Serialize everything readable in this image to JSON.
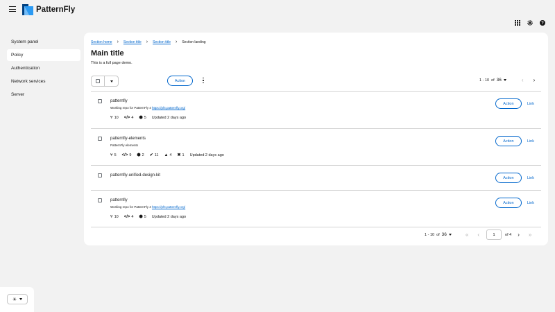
{
  "masthead": {
    "brand": "PatternFly",
    "icons": [
      "hamburger-icon",
      "grid-icon",
      "gear-icon",
      "help-icon"
    ]
  },
  "sidebar": {
    "items": [
      {
        "label": "System panel",
        "active": false
      },
      {
        "label": "Policy",
        "active": true
      },
      {
        "label": "Authentication",
        "active": false
      },
      {
        "label": "Network services",
        "active": false
      },
      {
        "label": "Server",
        "active": false
      }
    ],
    "theme_icon": "sun-icon"
  },
  "breadcrumb": {
    "items": [
      "Section home",
      "Section title",
      "Section title"
    ],
    "current": "Section landing"
  },
  "page": {
    "title": "Main title",
    "description": "This is a full page demo."
  },
  "toolbar": {
    "action_label": "Action"
  },
  "pagination": {
    "range": "1 - 10",
    "of": "of",
    "total": "36",
    "page_value": "1",
    "of_pages": "of 4"
  },
  "rows": [
    {
      "title": "patternfly",
      "desc_text": "Working repo for PatternFly 4",
      "desc_link": "https://pf4.patternfly.org/",
      "stats": [
        {
          "icon": "⑂",
          "value": "10",
          "name": "branch-icon"
        },
        {
          "icon": "</>",
          "value": "4",
          "name": "code-icon"
        },
        {
          "icon": "⬢",
          "value": "5",
          "name": "cube-icon"
        }
      ],
      "updated": "Updated 2 days ago",
      "action": "Action",
      "link": "Link"
    },
    {
      "title": "patternfly-elements",
      "desc_text": "PatternFly elements",
      "desc_link": "",
      "stats": [
        {
          "icon": "⑂",
          "value": "5",
          "name": "branch-icon"
        },
        {
          "icon": "</>",
          "value": "9",
          "name": "code-icon"
        },
        {
          "icon": "⬢",
          "value": "2",
          "name": "cube-icon"
        },
        {
          "icon": "✔",
          "value": "11",
          "name": "check-circle-icon"
        },
        {
          "icon": "▲",
          "value": "4",
          "name": "warning-icon"
        },
        {
          "icon": "✖",
          "value": "1",
          "name": "error-circle-icon"
        }
      ],
      "updated": "Updated 2 days ago",
      "action": "Action",
      "link": "Link"
    },
    {
      "title": "patternfly-unified-design-kit",
      "desc_text": "",
      "desc_link": "",
      "stats": [],
      "updated": "",
      "action": "Action",
      "link": "Link"
    },
    {
      "title": "patternfly",
      "desc_text": "Working repo for PatternFly 4",
      "desc_link": "https://pf4.patternfly.org/",
      "stats": [
        {
          "icon": "⑂",
          "value": "10",
          "name": "branch-icon"
        },
        {
          "icon": "</>",
          "value": "4",
          "name": "code-icon"
        },
        {
          "icon": "⬢",
          "value": "5",
          "name": "cube-icon"
        }
      ],
      "updated": "Updated 2 days ago",
      "action": "Action",
      "link": "Link"
    }
  ],
  "colors": {
    "link": "#0066cc",
    "text": "#151515",
    "background": "#f2f2f2"
  }
}
